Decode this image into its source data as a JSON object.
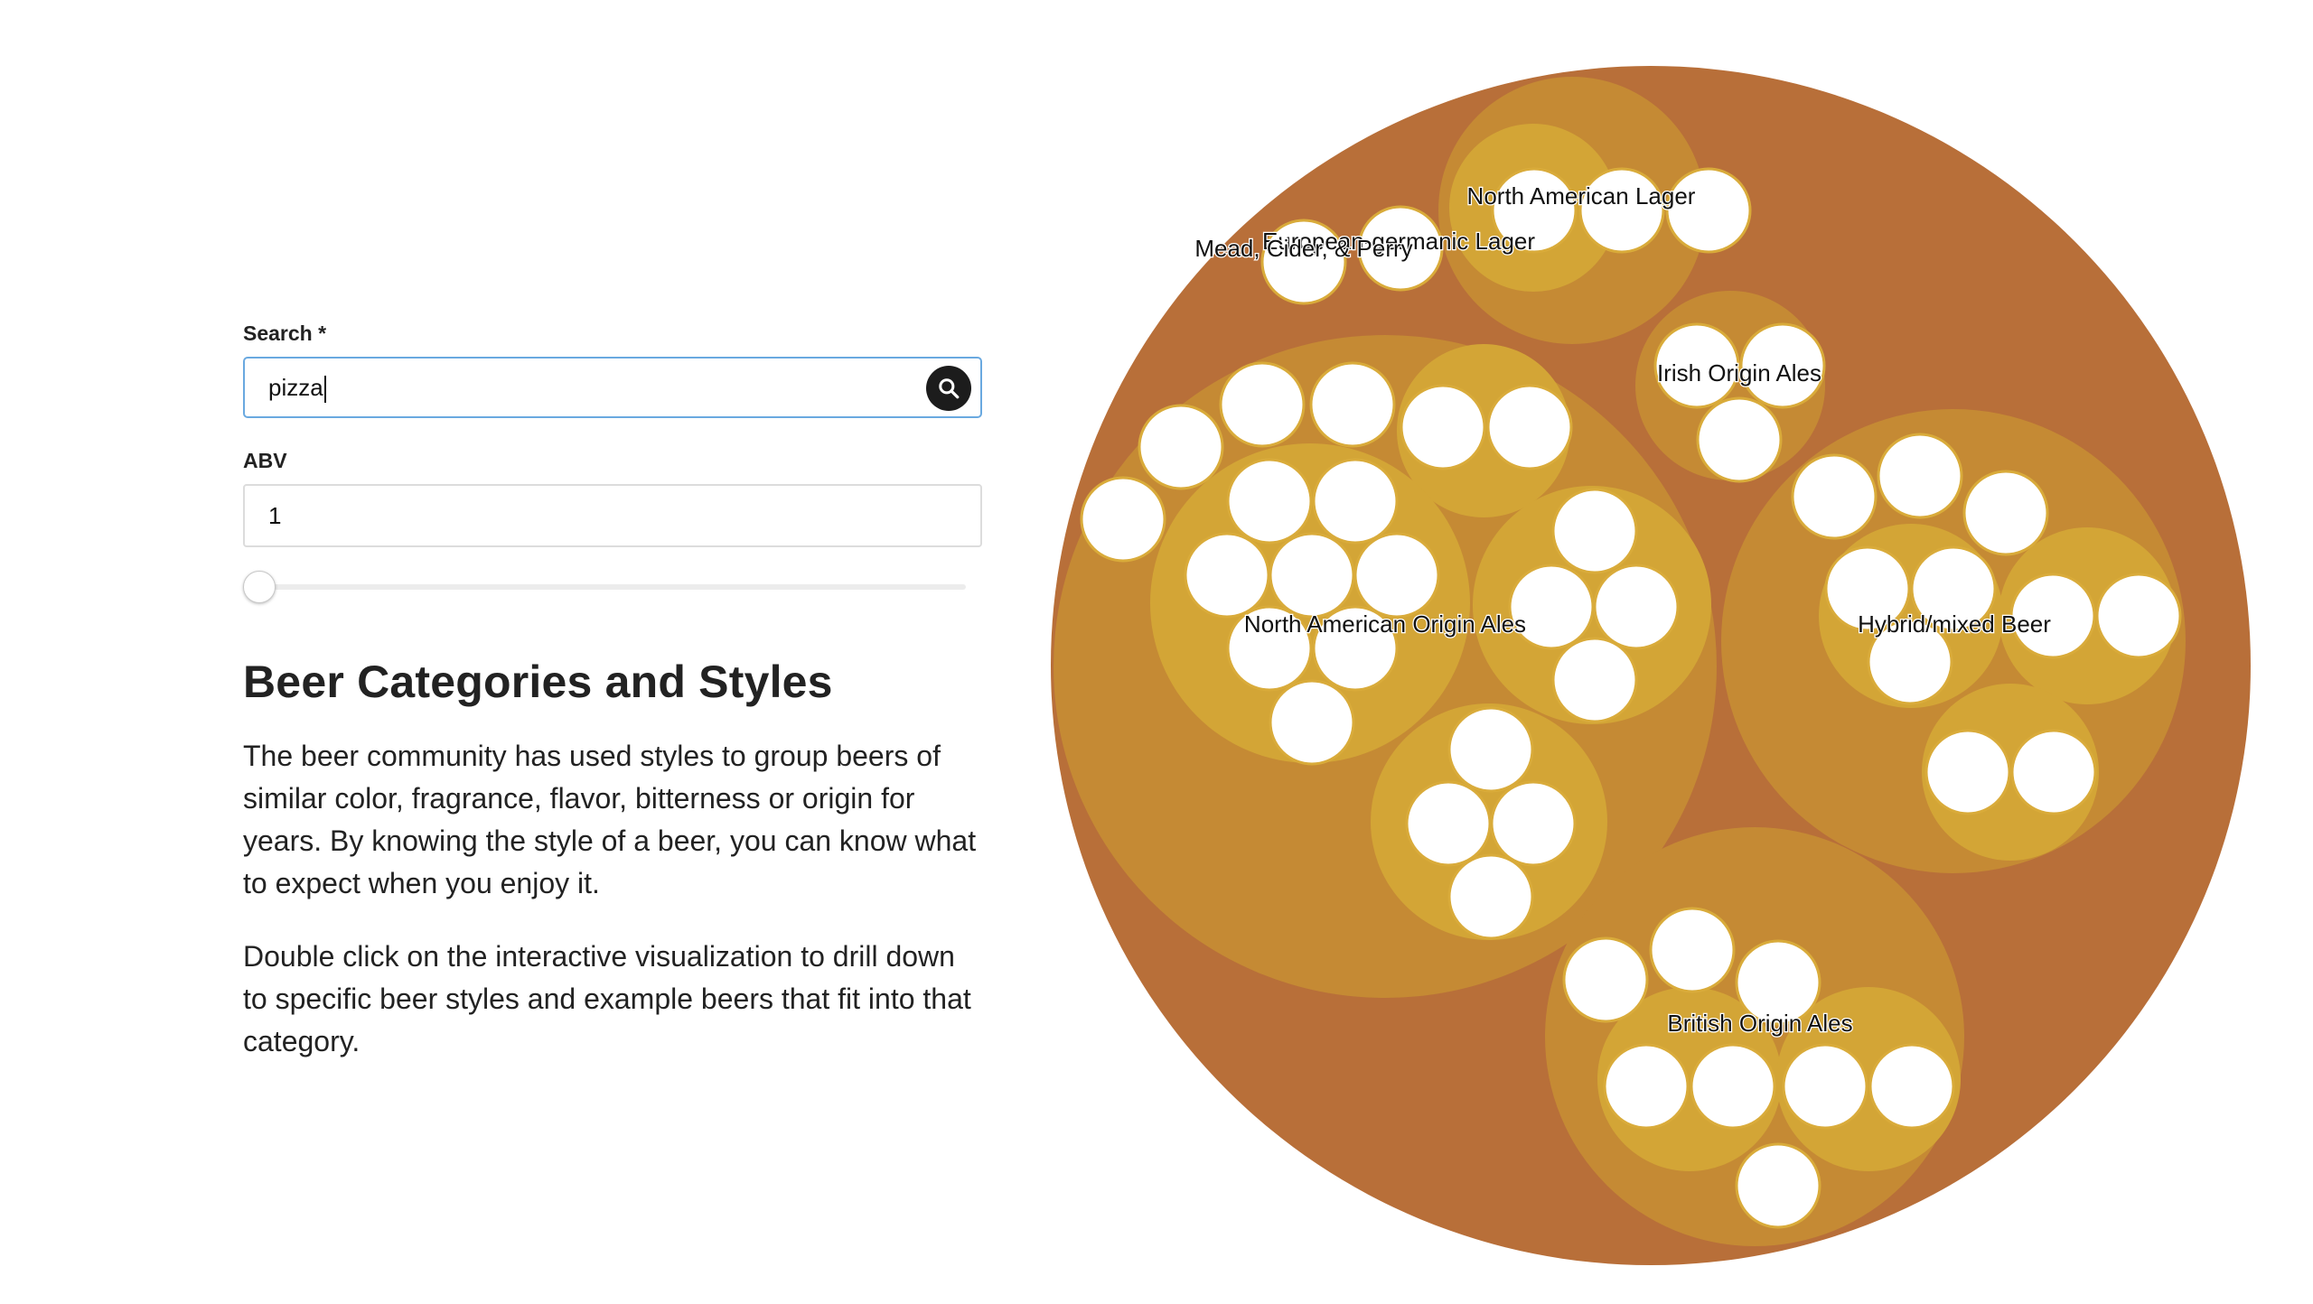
{
  "search": {
    "label": "Search *",
    "value": "pizza",
    "button_icon": "search-icon"
  },
  "abv": {
    "label": "ABV",
    "value": "1",
    "slider_level": 0
  },
  "content": {
    "title": "Beer Categories and Styles",
    "paragraphs": [
      "The beer community has used styles to group beers of similar color, fragrance, flavor, bitterness or origin for years. By knowing the style of a beer, you can know what to expect when you enjoy it.",
      "Double click on the interactive visualization to drill down to specific beer styles and example beers that fit into that category."
    ]
  },
  "colors": {
    "root_fill": "#b86f39",
    "category_fill": "#c58a34",
    "style_fill": "#d3a536",
    "leaf_fill": "#ffffff",
    "leaf_stroke": "#d9ab3a",
    "search_border": "#6aa9e0",
    "search_button": "#1c1c1c"
  },
  "visualization": {
    "type": "circle-packing",
    "category_labels": [
      "North American Lager",
      "European-germanic Lager",
      "Mead, Cider, & Perry",
      "Irish Origin Ales",
      "North American Origin Ales",
      "Hybrid/mixed Beer",
      "British Origin Ales"
    ]
  }
}
